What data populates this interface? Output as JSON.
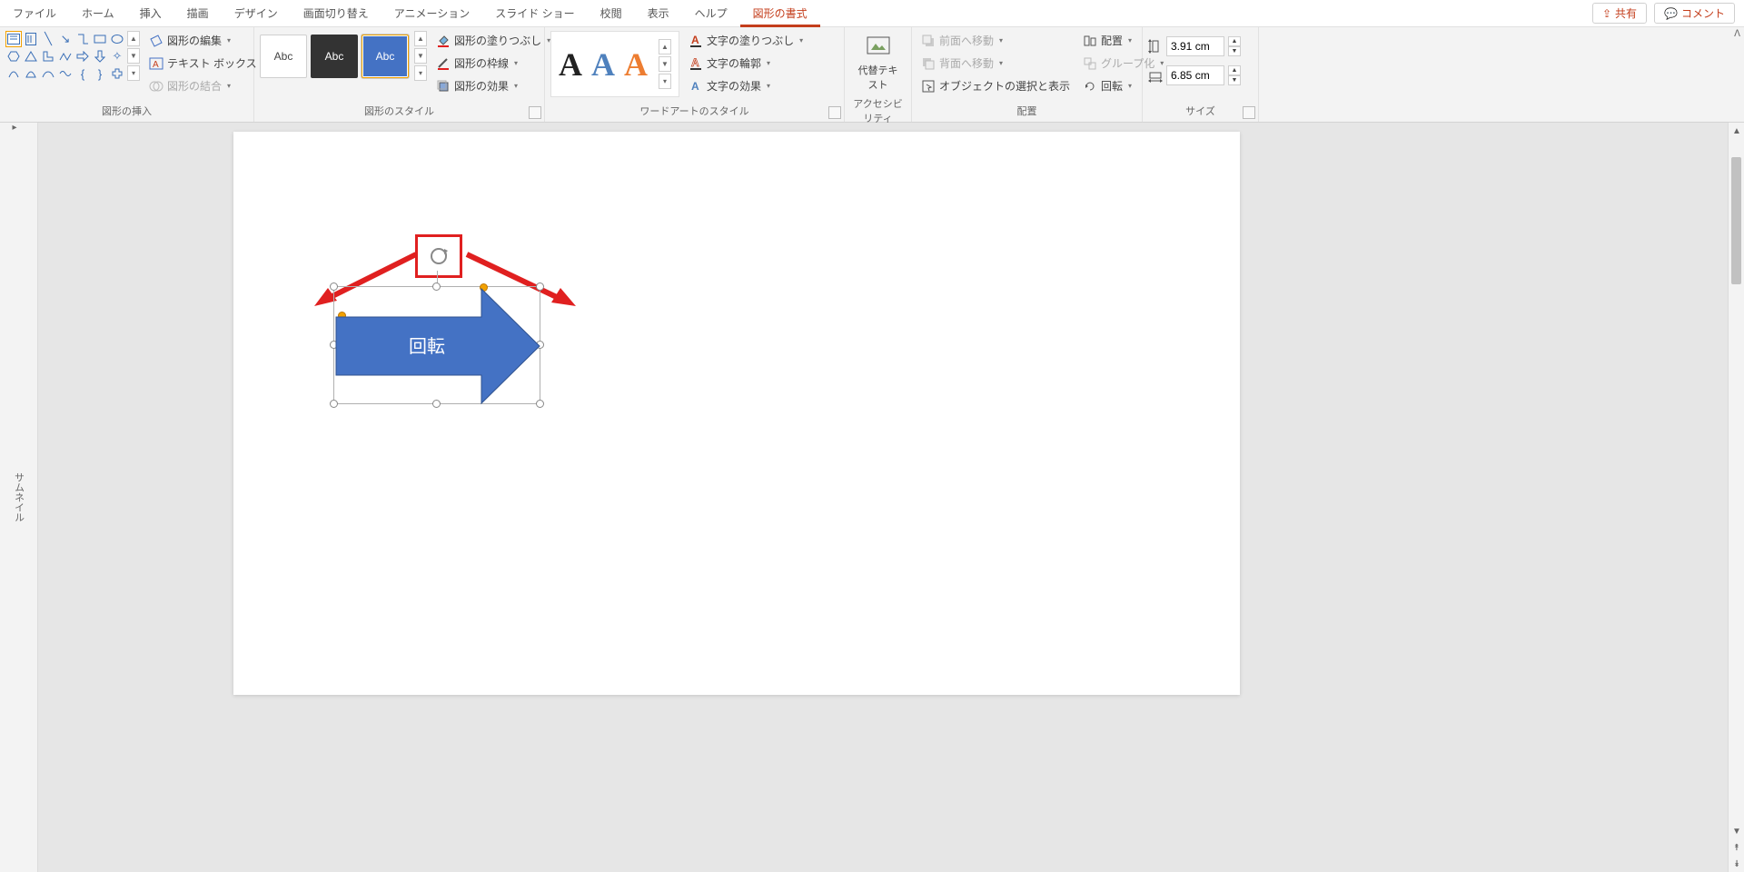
{
  "tabs": [
    "ファイル",
    "ホーム",
    "挿入",
    "描画",
    "デザイン",
    "画面切り替え",
    "アニメーション",
    "スライド ショー",
    "校閲",
    "表示",
    "ヘルプ",
    "図形の書式"
  ],
  "active_tab_index": 11,
  "topright": {
    "share": "共有",
    "comment": "コメント"
  },
  "ribbon": {
    "g1": {
      "label": "図形の挿入",
      "edit_shape": "図形の編集",
      "text_box": "テキスト ボックス",
      "merge": "図形の結合"
    },
    "g2": {
      "label": "図形のスタイル",
      "abc": "Abc",
      "fill": "図形の塗りつぶし",
      "outline": "図形の枠線",
      "effects": "図形の効果"
    },
    "g3": {
      "label": "ワードアートのスタイル",
      "glyph": "A",
      "text_fill": "文字の塗りつぶし",
      "text_outline": "文字の輪郭",
      "text_effects": "文字の効果"
    },
    "g4": {
      "label": "アクセシビリティ",
      "alt": "代替テキスト"
    },
    "g5": {
      "label": "配置",
      "bring_fwd": "前面へ移動",
      "send_back": "背面へ移動",
      "selection_pane": "オブジェクトの選択と表示",
      "align": "配置",
      "group": "グループ化",
      "rotate": "回転"
    },
    "g6": {
      "label": "サイズ",
      "height": "3.91 cm",
      "width": "6.85 cm"
    }
  },
  "thumbnail_pane": "サムネイル",
  "shape_text": "回転"
}
